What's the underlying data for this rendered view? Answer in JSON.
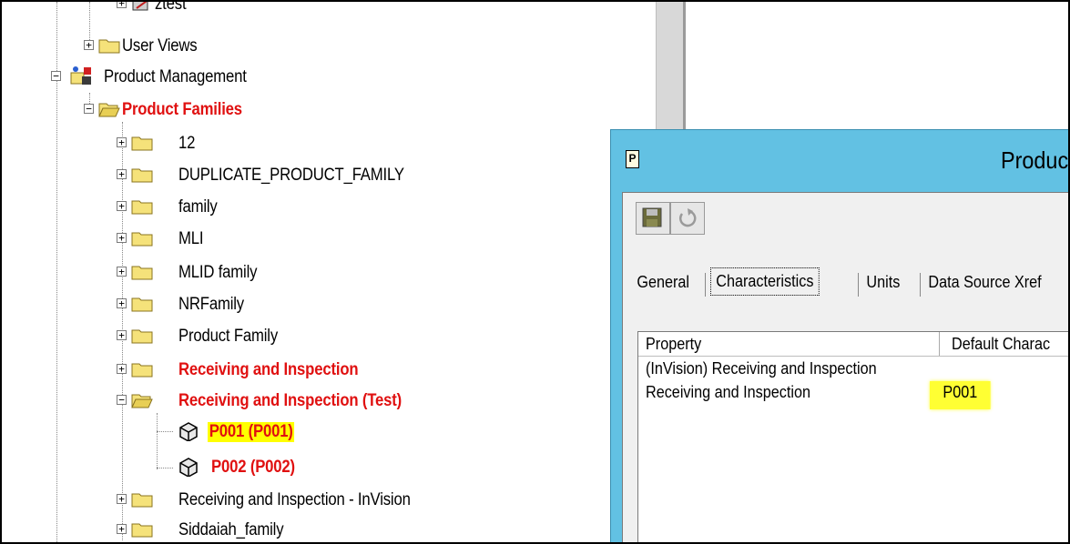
{
  "tree": {
    "nodes": [
      {
        "label": "ztest",
        "style": "normal"
      },
      {
        "label": "User Views",
        "style": "normal"
      },
      {
        "label": "Product Management",
        "style": "normal"
      },
      {
        "label": "Product Families",
        "style": "red"
      },
      {
        "label": "12",
        "style": "normal"
      },
      {
        "label": "DUPLICATE_PRODUCT_FAMILY",
        "style": "normal"
      },
      {
        "label": "family",
        "style": "normal"
      },
      {
        "label": "MLI",
        "style": "normal"
      },
      {
        "label": "MLID family",
        "style": "normal"
      },
      {
        "label": "NRFamily",
        "style": "normal"
      },
      {
        "label": "Product Family",
        "style": "normal"
      },
      {
        "label": "Receiving and Inspection",
        "style": "red"
      },
      {
        "label": "Receiving and Inspection (Test)",
        "style": "red"
      },
      {
        "label": "P001 (P001)",
        "style": "red-highlight"
      },
      {
        "label": "P002 (P002)",
        "style": "red"
      },
      {
        "label": "Receiving and Inspection - InVision",
        "style": "normal"
      },
      {
        "label": "Siddaiah_family",
        "style": "normal"
      }
    ]
  },
  "dialog": {
    "title": "Produc",
    "icon_letter": "P",
    "toolbar": {
      "save_icon": "save-icon",
      "refresh_icon": "refresh-icon"
    },
    "tabs": [
      "General",
      "Characteristics",
      "Units",
      "Data Source Xref"
    ],
    "active_tab": "Characteristics",
    "grid": {
      "headers": [
        "Property",
        "Default Charac"
      ],
      "rows": [
        {
          "property": "(InVision) Receiving and Inspection",
          "default": ""
        },
        {
          "property": "Receiving and Inspection",
          "default": "P001"
        }
      ]
    }
  },
  "colors": {
    "dialog_titlebar": "#62c1e3",
    "highlight": "#ffff00",
    "emphasis_text": "#e01010"
  }
}
